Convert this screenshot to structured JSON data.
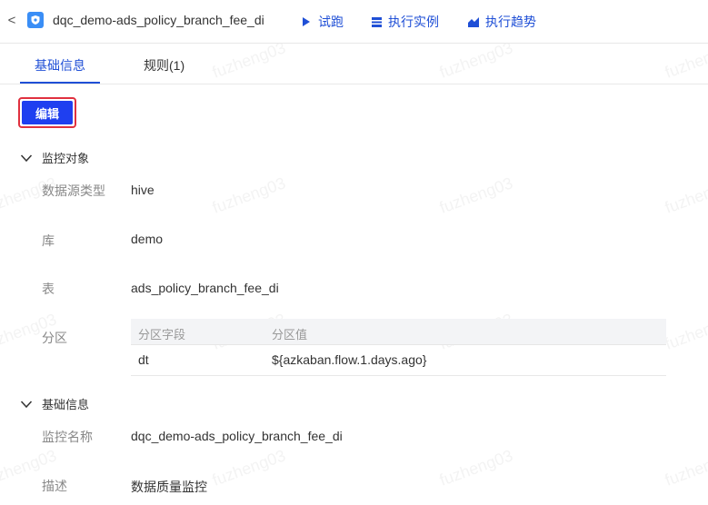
{
  "header": {
    "back_symbol": "<",
    "app_icon": "shield-icon",
    "title": "dqc_demo-ads_policy_branch_fee_di",
    "actions": [
      {
        "label": "试跑",
        "icon": "play-icon"
      },
      {
        "label": "执行实例",
        "icon": "list-icon"
      },
      {
        "label": "执行趋势",
        "icon": "trend-chart-icon"
      }
    ]
  },
  "tabs": [
    {
      "label": "基础信息",
      "active": true
    },
    {
      "label": "规则(1)",
      "active": false
    }
  ],
  "edit_button": {
    "label": "编辑"
  },
  "monitor_object": {
    "heading": "监控对象",
    "fields": [
      {
        "label": "数据源类型",
        "value": "hive"
      },
      {
        "label": "库",
        "value": "demo"
      },
      {
        "label": "表",
        "value": "ads_policy_branch_fee_di"
      }
    ],
    "partition": {
      "label": "分区",
      "columns": [
        "分区字段",
        "分区值"
      ],
      "rows": [
        [
          "dt",
          "${azkaban.flow.1.days.ago}"
        ]
      ]
    }
  },
  "basic_info": {
    "heading": "基础信息",
    "fields": [
      {
        "label": "监控名称",
        "value": "dqc_demo-ads_policy_branch_fee_di"
      },
      {
        "label": "描述",
        "value": "数据质量监控"
      }
    ]
  },
  "watermark": "fuzheng03",
  "colors": {
    "accent": "#1f4fd6",
    "button": "#1f3ff0",
    "highlight_border": "#e0313f",
    "app_icon": "#3a8ef6"
  }
}
